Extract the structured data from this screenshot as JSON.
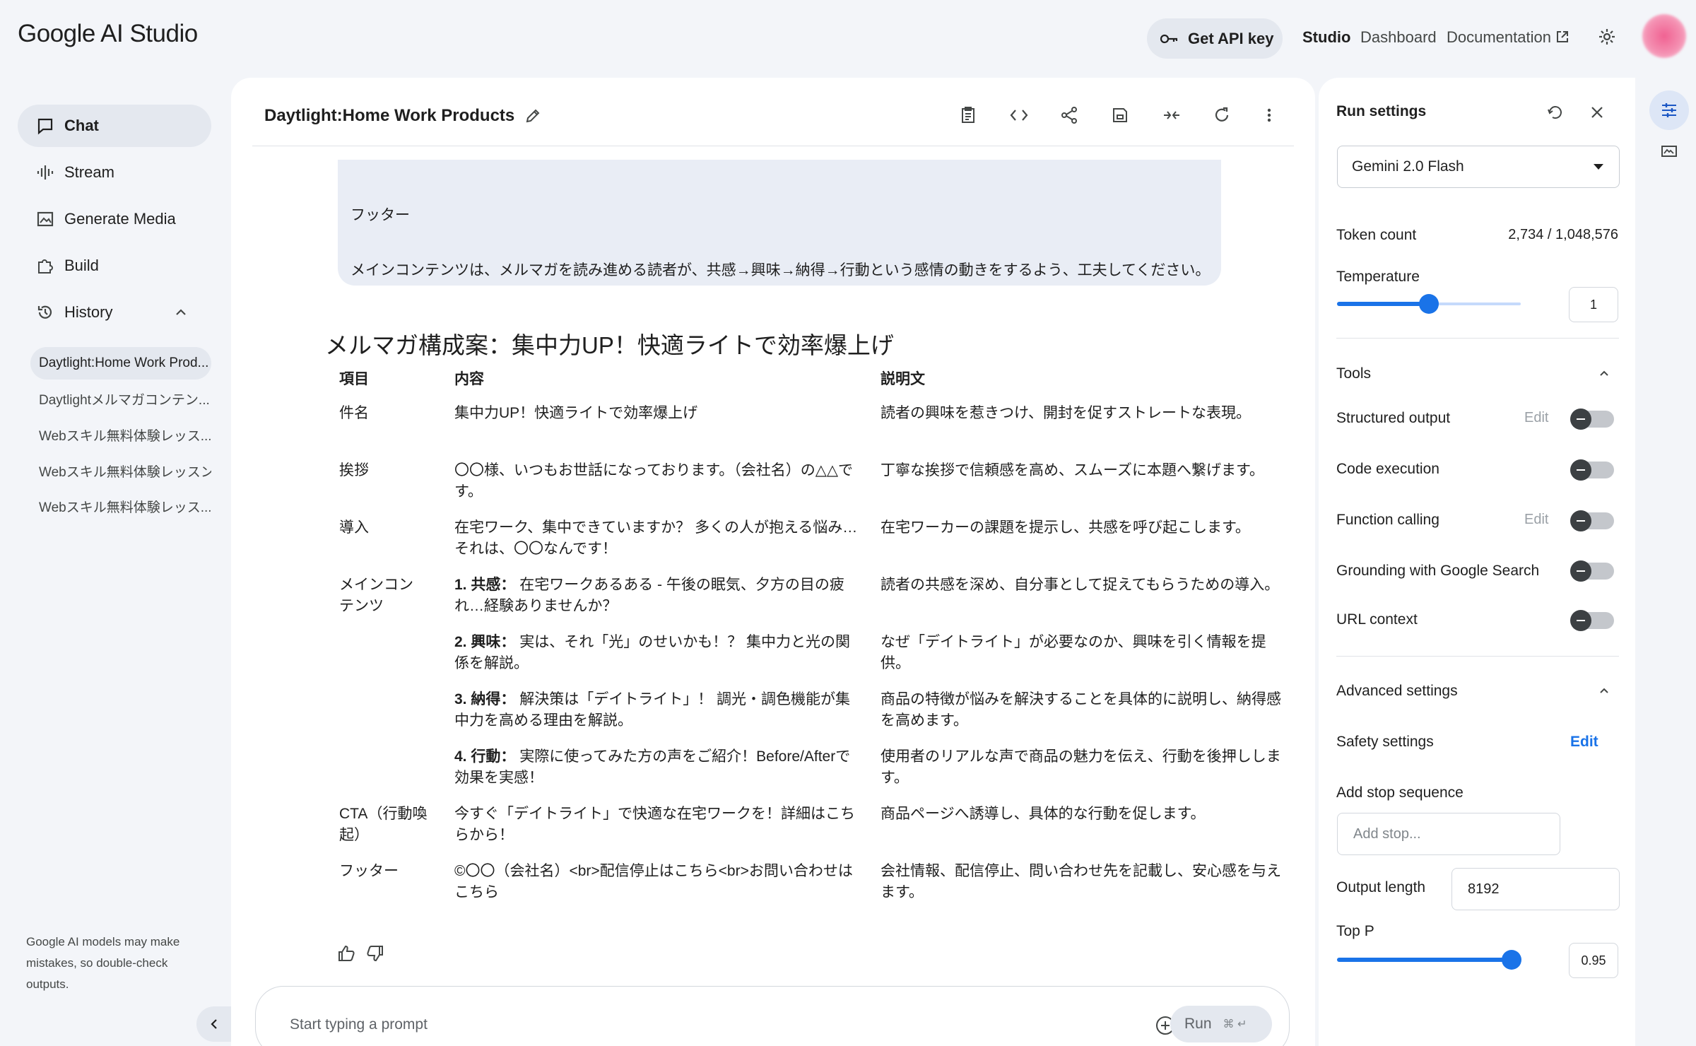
{
  "app": {
    "logo": "Google AI Studio",
    "get_api_key": "Get API key",
    "nav_links": [
      "Studio",
      "Dashboard",
      "Documentation"
    ]
  },
  "sidebar": {
    "items": [
      {
        "label": "Chat",
        "icon": "chat-icon"
      },
      {
        "label": "Stream",
        "icon": "waveform-icon"
      },
      {
        "label": "Generate Media",
        "icon": "image-icon"
      },
      {
        "label": "Build",
        "icon": "puzzle-icon"
      },
      {
        "label": "History",
        "icon": "history-icon"
      }
    ],
    "history": [
      "Daytlight:Home Work Prod...",
      "Daytlightメルマガコンテン...",
      "Webスキル無料体験レッス...",
      "Webスキル無料体験レッスン",
      "Webスキル無料体験レッス..."
    ],
    "disclaimer": "Google AI models may make mistakes, so double-check outputs."
  },
  "chat": {
    "title": "Daytlight:Home Work Products",
    "user_message": {
      "line1": "フッター",
      "line2": "メインコンテンツは、メルマガを読み進める読者が、共感→興味→納得→行動という感情の動きをするよう、工夫してください。"
    },
    "response_title": "メルマガ構成案：集中力UP！快適ライトで効率爆上げ",
    "table": {
      "headers": [
        "項目",
        "内容",
        "説明文"
      ],
      "rows": [
        {
          "item": "件名",
          "content": "集中力UP！快適ライトで効率爆上げ",
          "desc": "読者の興味を惹きつけ、開封を促すストレートな表現。"
        },
        {
          "item": "挨拶",
          "content": "〇〇様、いつもお世話になっております。（会社名）の△△です。",
          "desc": "丁寧な挨拶で信頼感を高め、スムーズに本題へ繋げます。"
        },
        {
          "item": "導入",
          "content": "在宅ワーク、集中できていますか？ 多くの人が抱える悩み… それは、〇〇なんです！",
          "desc": "在宅ワーカーの課題を提示し、共感を呼び起こします。"
        },
        {
          "item": "メインコンテンツ",
          "content_bold": "1. 共感：",
          "content": " 在宅ワークあるある - 午後の眠気、夕方の目の疲れ…経験ありませんか？",
          "desc": "読者の共感を深め、自分事として捉えてもらうための導入。"
        },
        {
          "item": "",
          "content_bold": "2. 興味：",
          "content": " 実は、それ「光」のせいかも！？ 集中力と光の関係を解説。",
          "desc": "なぜ「デイトライト」が必要なのか、興味を引く情報を提供。"
        },
        {
          "item": "",
          "content_bold": "3. 納得：",
          "content": " 解決策は「デイトライト」！ 調光・調色機能が集中力を高める理由を解説。",
          "desc": "商品の特徴が悩みを解決することを具体的に説明し、納得感を高めます。"
        },
        {
          "item": "",
          "content_bold": "4. 行動：",
          "content": " 実際に使ってみた方の声をご紹介！Before/Afterで効果を実感！",
          "desc": "使用者のリアルな声で商品の魅力を伝え、行動を後押しします。"
        },
        {
          "item": "CTA（行動喚起）",
          "content": "今すぐ「デイトライト」で快適な在宅ワークを！詳細はこちらから！",
          "desc": "商品ページへ誘導し、具体的な行動を促します。"
        },
        {
          "item": "フッター",
          "content": "©〇〇（会社名）<br>配信停止はこちら<br>お問い合わせはこちら",
          "desc": "会社情報、配信停止、問い合わせ先を記載し、安心感を与えます。"
        }
      ]
    },
    "prompt_placeholder": "Start typing a prompt",
    "run_label": "Run",
    "run_shortcut": "⌘ ↵"
  },
  "run_settings": {
    "title": "Run settings",
    "model": "Gemini 2.0 Flash",
    "token_count_label": "Token count",
    "token_count_value": "2,734 / 1,048,576",
    "temperature_label": "Temperature",
    "temperature_value": "1",
    "temperature_fraction": 0.5,
    "tools_label": "Tools",
    "tools": [
      {
        "label": "Structured output",
        "edit": "Edit",
        "enabled": false
      },
      {
        "label": "Code execution",
        "enabled": false
      },
      {
        "label": "Function calling",
        "edit": "Edit",
        "enabled": false
      },
      {
        "label": "Grounding with Google Search",
        "enabled": false
      },
      {
        "label": "URL context",
        "enabled": false
      }
    ],
    "advanced_label": "Advanced settings",
    "safety_label": "Safety settings",
    "safety_edit": "Edit",
    "stop_label": "Add stop sequence",
    "stop_placeholder": "Add stop...",
    "output_length_label": "Output length",
    "output_length_value": "8192",
    "top_p_label": "Top P",
    "top_p_value": "0.95",
    "top_p_fraction": 0.95
  },
  "colors": {
    "accent": "#1a73e8",
    "background": "#f3f5f9"
  }
}
